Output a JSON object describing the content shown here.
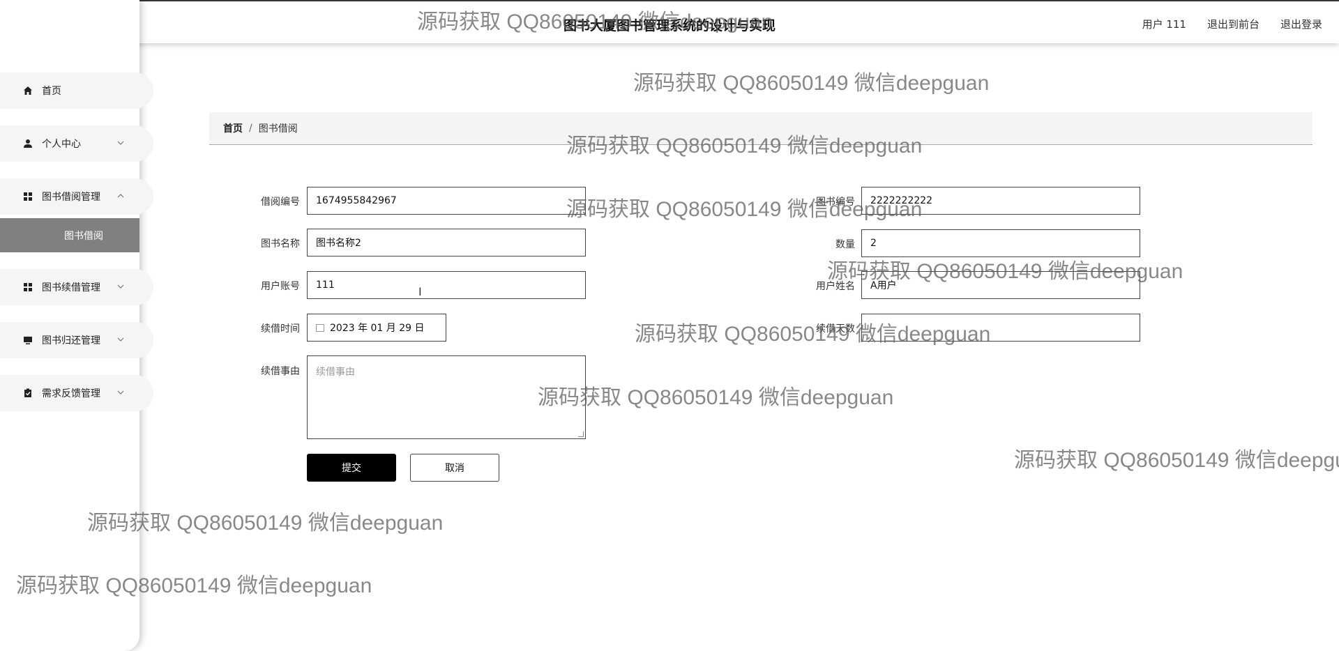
{
  "header": {
    "title": "图书大厦图书管理系统的设计与实现",
    "user_label": "用户 111",
    "to_front": "退出到前台",
    "logout": "退出登录"
  },
  "sidebar": {
    "items": [
      {
        "label": "首页",
        "icon": "home-icon"
      },
      {
        "label": "个人中心",
        "icon": "user-icon"
      },
      {
        "label": "图书借阅管理",
        "icon": "grid-icon"
      },
      {
        "label": "图书续借管理",
        "icon": "grid-icon"
      },
      {
        "label": "图书归还管理",
        "icon": "monitor-icon"
      },
      {
        "label": "需求反馈管理",
        "icon": "clipboard-check-icon"
      }
    ],
    "active_sub": "图书借阅"
  },
  "breadcrumb": {
    "home": "首页",
    "separator": "/",
    "current": "图书借阅"
  },
  "form": {
    "borrow_no": {
      "label": "借阅编号",
      "value": "1674955842967"
    },
    "book_no": {
      "label": "图书编号",
      "value": "2222222222"
    },
    "book_name": {
      "label": "图书名称",
      "value": "图书名称2"
    },
    "quantity": {
      "label": "数量",
      "value": "2"
    },
    "user_account": {
      "label": "用户账号",
      "value": "111"
    },
    "user_name": {
      "label": "用户姓名",
      "value": "A用户"
    },
    "renew_time": {
      "label": "续借时间",
      "value": "2023 年 01 月 29 日"
    },
    "renew_days": {
      "label": "续借天数",
      "value": ""
    },
    "renew_reason": {
      "label": "续借事由",
      "placeholder": "续借事由"
    },
    "submit": "提交",
    "cancel": "取消"
  },
  "watermark": "源码获取 QQ86050149 微信deepguan",
  "colors": {
    "accent": "#000000",
    "active_sub_bg": "#808080",
    "menu_bg": "#f6f4f5"
  }
}
